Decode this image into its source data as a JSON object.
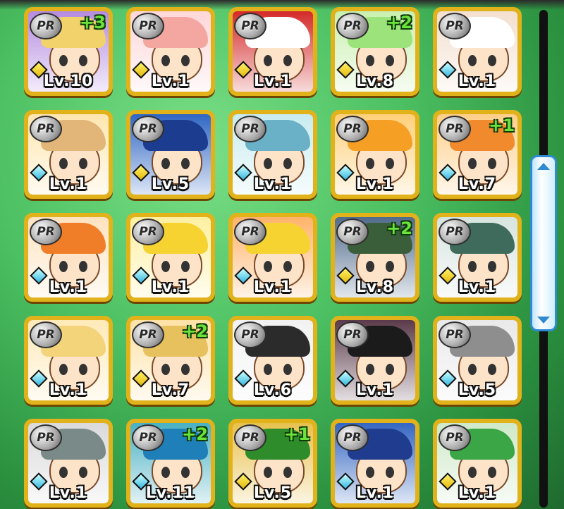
{
  "badge_label": "PR",
  "cards": [
    {
      "level": "Lv.10",
      "plus": "+3",
      "gem": "yellow",
      "hair": "#f2d26a",
      "bg": "#b58be0"
    },
    {
      "level": "Lv.1",
      "plus": "",
      "gem": "yellow",
      "hair": "#f4a7a0",
      "bg": "#ffd7d9"
    },
    {
      "level": "Lv.1",
      "plus": "",
      "gem": "yellow",
      "hair": "#ffffff",
      "bg": "#d42a2a"
    },
    {
      "level": "Lv.8",
      "plus": "+2",
      "gem": "yellow",
      "hair": "#9be37a",
      "bg": "#c9f0b0"
    },
    {
      "level": "Lv.1",
      "plus": "",
      "gem": "blue",
      "hair": "#ffffff",
      "bg": "#f3e0d0"
    },
    {
      "level": "Lv.1",
      "plus": "",
      "gem": "blue",
      "hair": "#e2b679",
      "bg": "#ffe6b0"
    },
    {
      "level": "Lv.5",
      "plus": "",
      "gem": "yellow",
      "hair": "#1c3d8f",
      "bg": "#2f66c4"
    },
    {
      "level": "Lv.1",
      "plus": "",
      "gem": "blue",
      "hair": "#6ab0c6",
      "bg": "#c8ecf0"
    },
    {
      "level": "Lv.1",
      "plus": "",
      "gem": "blue",
      "hair": "#f5a024",
      "bg": "#ffd07a"
    },
    {
      "level": "Lv.7",
      "plus": "+1",
      "gem": "blue",
      "hair": "#f08a2c",
      "bg": "#ffcf8a"
    },
    {
      "level": "Lv.1",
      "plus": "",
      "gem": "blue",
      "hair": "#f07d28",
      "bg": "#ffe3c0"
    },
    {
      "level": "Lv.1",
      "plus": "",
      "gem": "blue",
      "hair": "#f6d331",
      "bg": "#fff0a0"
    },
    {
      "level": "Lv.1",
      "plus": "",
      "gem": "blue",
      "hair": "#f6d331",
      "bg": "#ffb36a"
    },
    {
      "level": "Lv.8",
      "plus": "+2",
      "gem": "yellow",
      "hair": "#3b5e3a",
      "bg": "#516b8c"
    },
    {
      "level": "Lv.1",
      "plus": "",
      "gem": "yellow",
      "hair": "#3e6b5c",
      "bg": "#d7e4e0"
    },
    {
      "level": "Lv.1",
      "plus": "",
      "gem": "blue",
      "hair": "#f3d47a",
      "bg": "#ffe9b8"
    },
    {
      "level": "Lv.7",
      "plus": "+2",
      "gem": "yellow",
      "hair": "#e6c15d",
      "bg": "#ffe2a6"
    },
    {
      "level": "Lv.6",
      "plus": "",
      "gem": "blue",
      "hair": "#2b2b2b",
      "bg": "#f2f2f2"
    },
    {
      "level": "Lv.1",
      "plus": "",
      "gem": "blue",
      "hair": "#1b1b1b",
      "bg": "#5a3a4a"
    },
    {
      "level": "Lv.5",
      "plus": "",
      "gem": "blue",
      "hair": "#8e8e8e",
      "bg": "#e9e9e9"
    },
    {
      "level": "Lv.1",
      "plus": "",
      "gem": "blue",
      "hair": "#7a8a88",
      "bg": "#dadada"
    },
    {
      "level": "Lv.11",
      "plus": "+2",
      "gem": "blue",
      "hair": "#1f7fb8",
      "bg": "#4ab0c2"
    },
    {
      "level": "Lv.5",
      "plus": "+1",
      "gem": "yellow",
      "hair": "#2f8c2a",
      "bg": "#e8c14e"
    },
    {
      "level": "Lv.1",
      "plus": "",
      "gem": "blue",
      "hair": "#1f3c8f",
      "bg": "#3466c2"
    },
    {
      "level": "Lv.1",
      "plus": "",
      "gem": "yellow",
      "hair": "#3ba645",
      "bg": "#cfe9c9"
    }
  ],
  "scrollbar": {
    "up_icon": "chevron-up-icon",
    "down_icon": "chevron-down-icon"
  }
}
